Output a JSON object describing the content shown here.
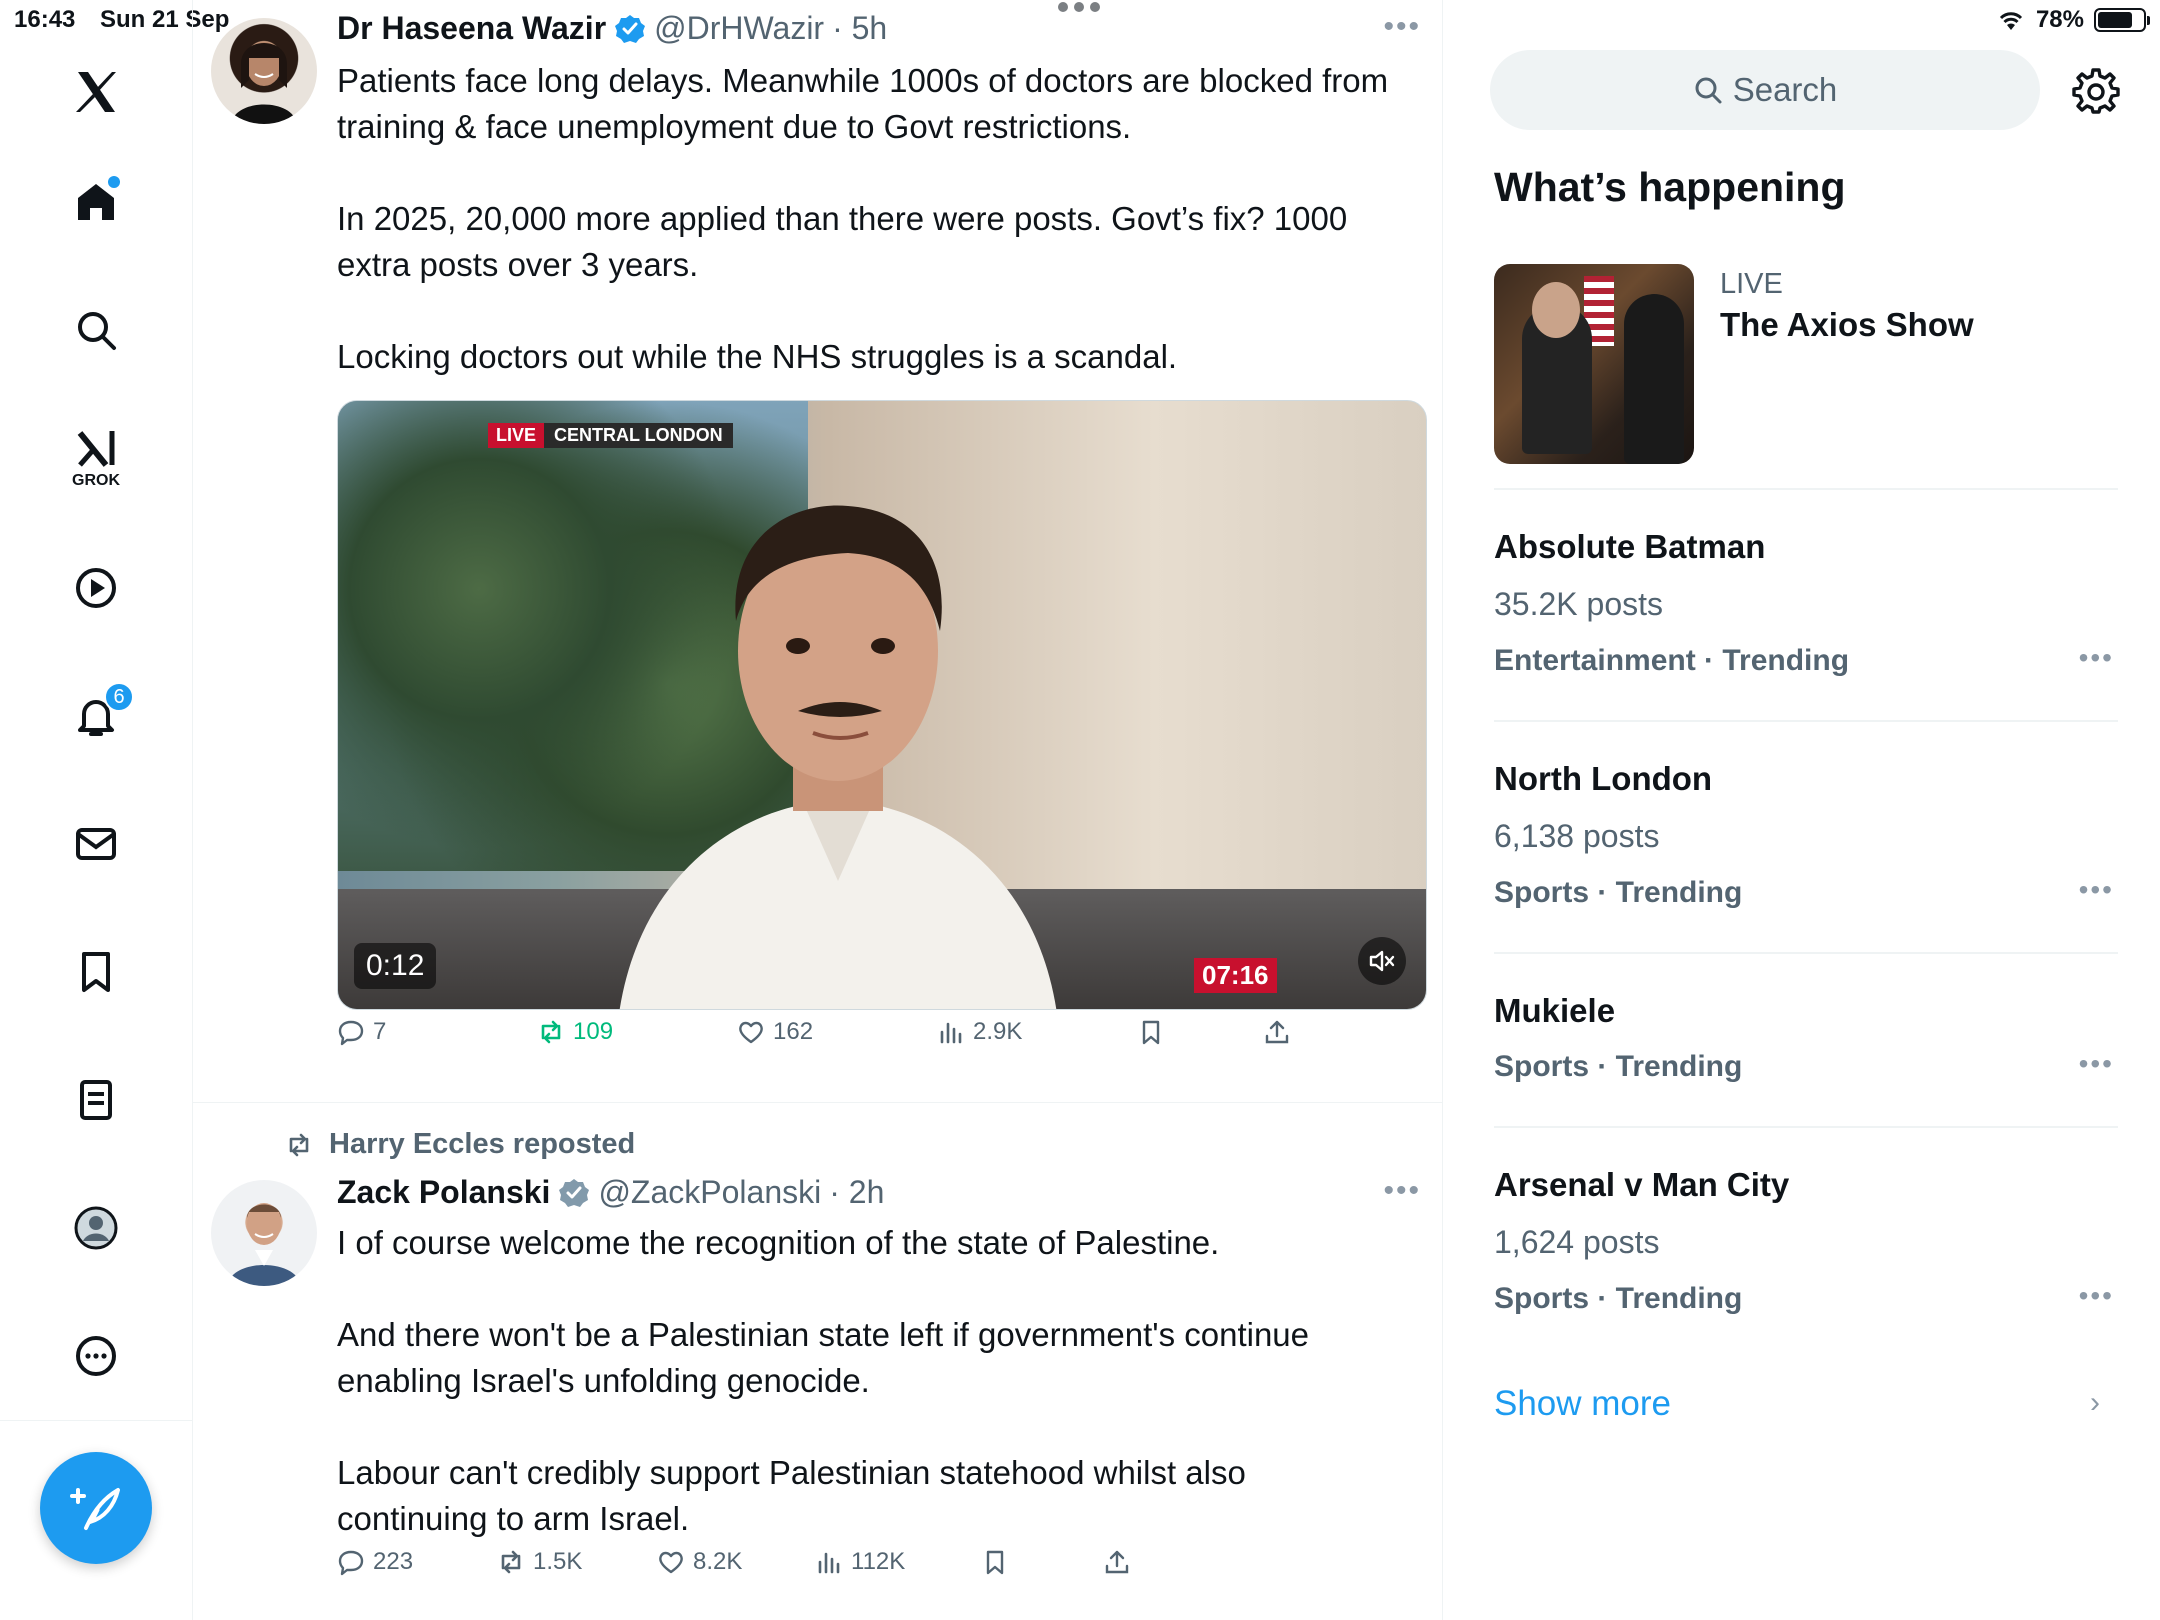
{
  "status_bar": {
    "time": "16:43",
    "date": "Sun 21 Sep",
    "battery": "78%",
    "battery_level": 0.78
  },
  "nav": {
    "items": [
      {
        "name": "x-logo"
      },
      {
        "name": "home"
      },
      {
        "name": "search"
      },
      {
        "name": "grok",
        "label": "GROK"
      },
      {
        "name": "video"
      },
      {
        "name": "notifications",
        "badge": "6"
      },
      {
        "name": "messages"
      },
      {
        "name": "bookmarks"
      },
      {
        "name": "lists"
      },
      {
        "name": "profile"
      },
      {
        "name": "more"
      }
    ]
  },
  "posts": [
    {
      "name": "Dr Haseena Wazir",
      "handle": "@DrHWazir",
      "time": "· 5h",
      "paragraphs": [
        "Patients face long delays. Meanwhile 1000s of doctors are blocked from training & face unemployment due to Govt restrictions.",
        "In 2025, 20,000 more applied than there were posts. Govt’s fix? 1000 extra posts over 3 years.",
        "Locking doctors out while the NHS struggles is a scandal."
      ],
      "video": {
        "live": "LIVE",
        "location": "CENTRAL LONDON",
        "elapsed": "0:12",
        "clock": "07:16"
      },
      "actions": {
        "replies": "7",
        "reposts": "109",
        "likes": "162",
        "views": "2.9K"
      }
    },
    {
      "repost_by": "Harry Eccles reposted",
      "name": "Zack Polanski",
      "handle": "@ZackPolanski",
      "time": "· 2h",
      "paragraphs": [
        "I of course welcome the recognition of the state of Palestine.",
        "And there won't be a Palestinian state left if government's continue enabling Israel's unfolding genocide.",
        "Labour can't credibly support Palestinian statehood whilst also continuing to arm Israel."
      ],
      "actions": {
        "replies": "223",
        "reposts": "1.5K",
        "likes": "8.2K",
        "views": "112K"
      }
    }
  ],
  "sidebar": {
    "search_placeholder": "Search",
    "section_title": "What’s happening",
    "live": {
      "label": "LIVE",
      "title": "The Axios Show"
    },
    "trends": [
      {
        "name": "Absolute Batman",
        "posts": "35.2K posts",
        "category": "Entertainment · Trending"
      },
      {
        "name": "North London",
        "posts": "6,138 posts",
        "category": "Sports · Trending"
      },
      {
        "name": "Mukiele",
        "posts": "",
        "category": "Sports · Trending"
      },
      {
        "name": "Arsenal v Man City",
        "posts": "1,624 posts",
        "category": "Sports · Trending"
      }
    ],
    "show_more": "Show more"
  },
  "colors": {
    "accent": "#1d9bf0",
    "text": "#0f1419",
    "secondary": "#536471",
    "repost_green": "#00ba7c"
  }
}
